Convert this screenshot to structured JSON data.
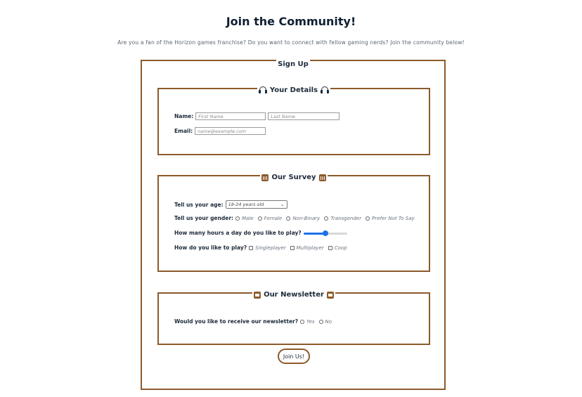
{
  "page": {
    "title": "Join the Community!",
    "intro": "Are you a fan of the Horizon games franchise? Do you want to connect with fellow gaming nerds? Join the community below!"
  },
  "form": {
    "legend": "Sign Up",
    "details": {
      "legend": "Your Details",
      "icon": "headphones-icon",
      "name_label": "Name:",
      "first_name_placeholder": "First Name",
      "last_name_placeholder": "Last Name",
      "email_label": "Email:",
      "email_placeholder": "name@example.com"
    },
    "survey": {
      "legend": "Our Survey",
      "icon": "bar-chart-icon",
      "age_label": "Tell us your age:",
      "age_selected": "18-24 years old",
      "gender_label": "Tell us your gender:",
      "gender_options": [
        "Male",
        "Female",
        "Non-Binary",
        "Transgender",
        "Prefer Not To Say"
      ],
      "hours_label": "How many hours a day do you like to play?",
      "hours_level_percent": 50,
      "play_label": "How do you like to play?",
      "play_options": [
        "Singleplayer",
        "Multiplayer",
        "Coop"
      ]
    },
    "newsletter": {
      "legend": "Our Newsletter",
      "icon": "envelope-icon",
      "question": "Would you like to receive our newsletter?",
      "options": [
        "Yes",
        "No"
      ]
    },
    "submit_label": "Join Us!"
  },
  "colors": {
    "border": "#8c5a2b",
    "accent": "#1a73e8",
    "heading": "#0f1f33"
  }
}
